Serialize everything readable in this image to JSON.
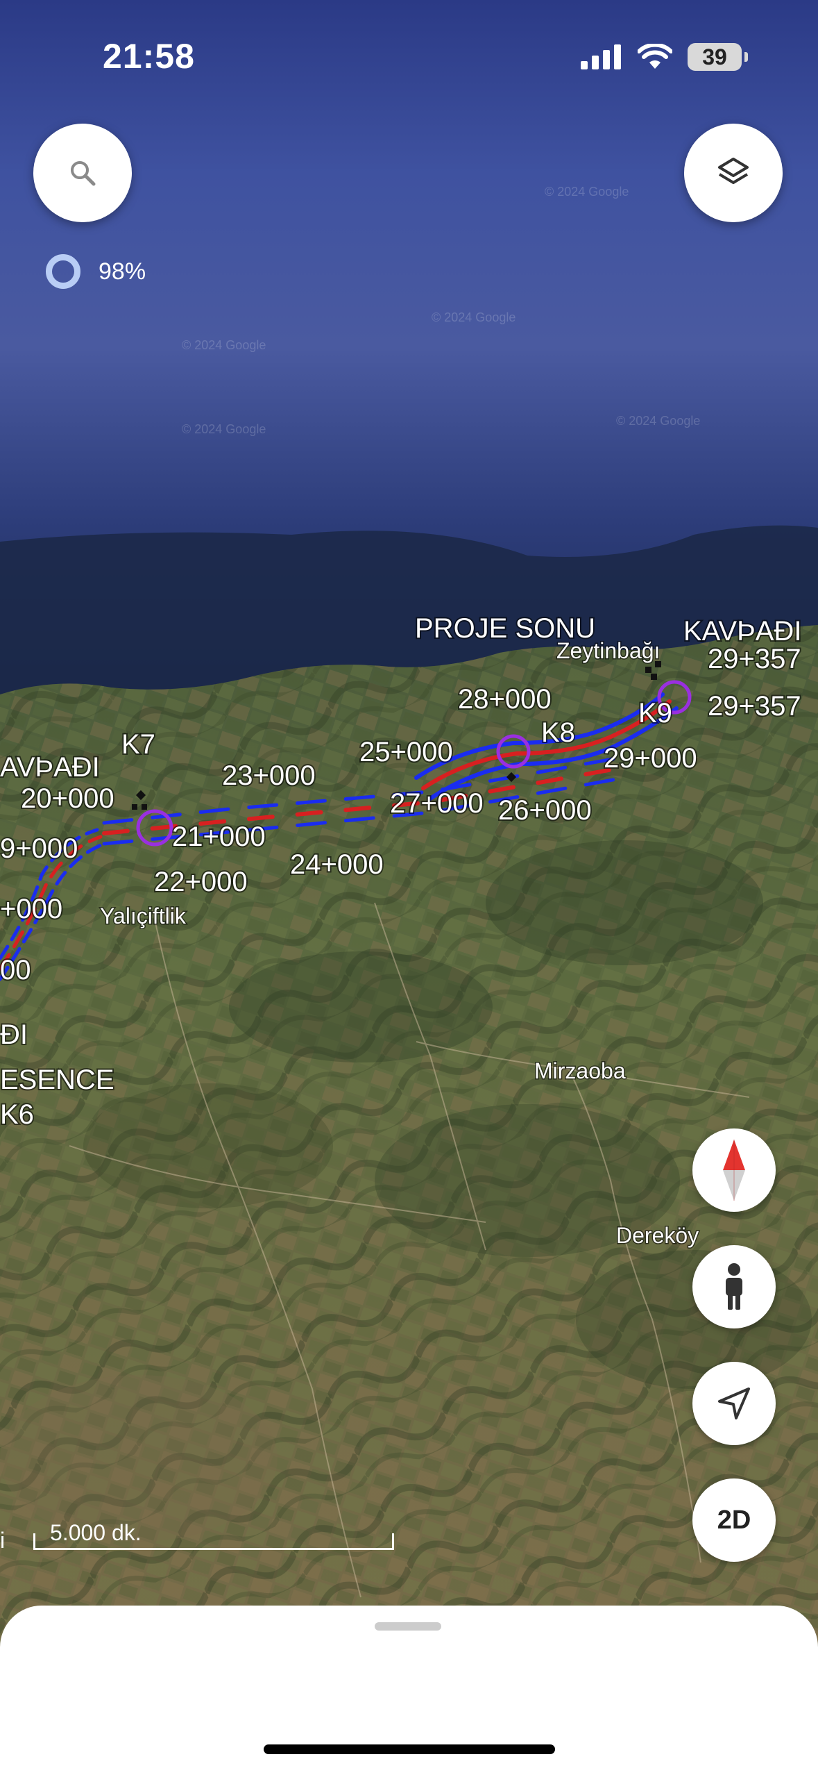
{
  "status_bar": {
    "time": "21:58",
    "battery": "39"
  },
  "loading": {
    "percent": "98%"
  },
  "map": {
    "watermark": "© 2024 Google",
    "road_labels": {
      "kavsagi_left": "AVÞAÐI",
      "k7": "K7",
      "km20": "20+000",
      "km19": "9+000",
      "km18": "+000",
      "km17": "00",
      "kavsagi_left2": "ÐI",
      "presence": "ESENCE",
      "k6": "K6",
      "km21": "21+000",
      "km22": "22+000",
      "km23": "23+000",
      "km24": "24+000",
      "km25": "25+000",
      "km26": "26+000",
      "km27": "27+000",
      "km28": "28+000",
      "k8": "K8",
      "k9": "K9",
      "km29": "29+000",
      "km29_357a": "29+357",
      "km29_357b": "29+357",
      "proje_sonu": "PROJE SONU",
      "kavsagi_right": "KAVÞAÐI"
    },
    "place_labels": {
      "zeytinbagi": "Zeytinbağı",
      "yaliciftlik": "Yalıçiftlik",
      "mirzaoba": "Mirzaoba",
      "derekoy": "Dereköy"
    },
    "colors": {
      "sea": "#3d4f98",
      "route_red": "#d82020",
      "route_blue": "#1a2cf0",
      "interchange": "#9a2fe0"
    }
  },
  "controls": {
    "search_icon": "search-icon",
    "layers_icon": "layers-icon",
    "compass_icon": "compass-icon",
    "street_view_icon": "pegman-icon",
    "location_icon": "navigation-arrow-icon",
    "view_mode": "2D"
  },
  "scale": {
    "label": "5.000 dk.",
    "left_fragment": "i"
  }
}
